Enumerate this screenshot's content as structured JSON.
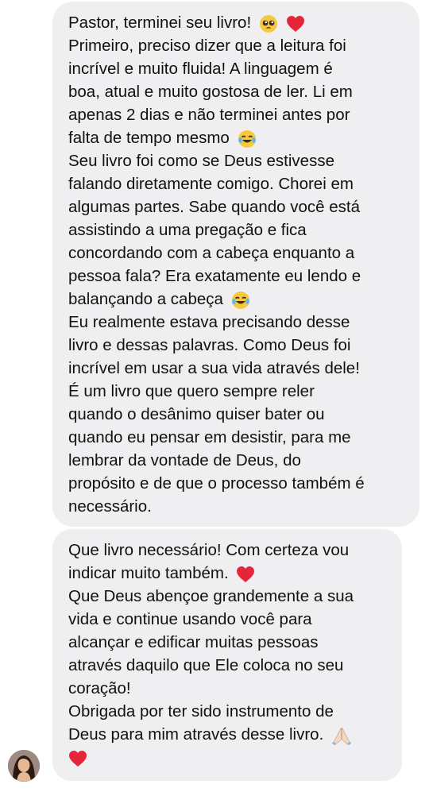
{
  "messages": [
    {
      "lines": [
        "Pastor, terminei seu livro!",
        "Primeiro, preciso dizer que a leitura foi",
        "incrível e muito fluida! A linguagem é",
        "boa, atual e muito gostosa de ler. Li em",
        "apenas 2 dias e não terminei antes por",
        "falta de tempo mesmo",
        "Seu livro foi como se Deus estivesse",
        "falando diretamente comigo. Chorei em",
        "algumas partes. Sabe quando você está",
        "assistindo a uma pregação e fica",
        "concordando com a cabeça enquanto a",
        "pessoa fala? Era exatamente eu lendo e",
        "balançando a cabeça",
        "Eu realmente estava precisando desse",
        "livro e dessas palavras. Como Deus foi",
        "incrível em usar a sua vida através dele!",
        "É um livro que quero sempre reler",
        "quando o desânimo quiser bater ou",
        "quando eu pensar em desistir, para me",
        "lembrar da vontade de Deus, do",
        "propósito e de que o processo também é",
        "necessário."
      ]
    },
    {
      "lines": [
        "Que livro necessário! Com certeza vou",
        "indicar muito também.",
        "Que Deus abençoe grandemente a sua",
        "vida e continue usando você para",
        "alcançar e edificar muitas pessoas",
        "através daquilo que Ele coloca no seu",
        "coração!",
        "Obrigada por ter sido instrumento de",
        "Deus para mim através desse livro."
      ]
    }
  ],
  "emoji_icons": [
    "pleading-face-icon",
    "red-heart-icon",
    "tears-of-joy-icon",
    "folded-hands-icon"
  ]
}
